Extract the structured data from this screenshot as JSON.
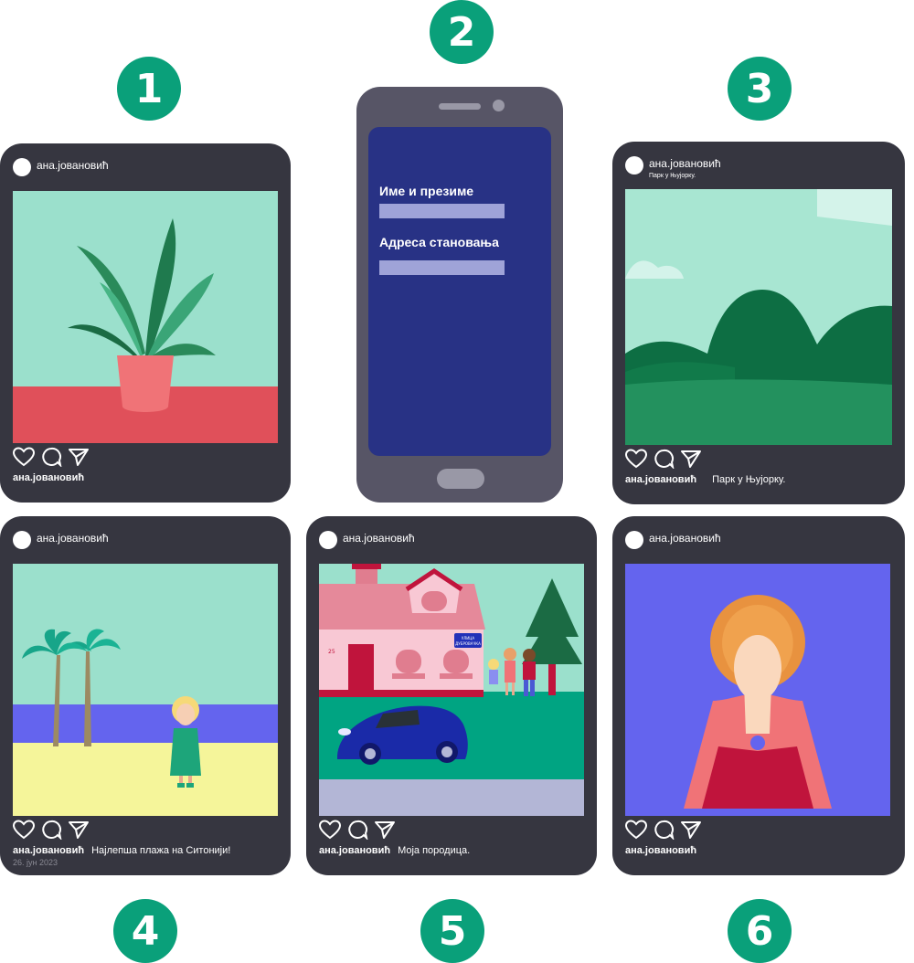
{
  "badges": [
    "1",
    "2",
    "3",
    "4",
    "5",
    "6"
  ],
  "username": "ана.јовановић",
  "phone": {
    "field1_label": "Име и презиме",
    "field2_label": "Адреса становања"
  },
  "posts": [
    {
      "id": 1,
      "caption": ""
    },
    {
      "id": 3,
      "location": "Парк у Њујорку.",
      "caption": "Парк у Њујорку."
    },
    {
      "id": 4,
      "caption": "Најлепша плажа на Ситонији!",
      "date": "26. јун 2023"
    },
    {
      "id": 5,
      "caption": "Моја породица.",
      "street_sign": "УЛИЦА ДУБРОВАЧКА",
      "house_number": "25"
    },
    {
      "id": 6,
      "caption": ""
    }
  ],
  "colors": {
    "badge": "#0aa07a",
    "card": "#363640",
    "phone_body": "#575566",
    "phone_screen": "#283285"
  },
  "icons": [
    "heart-icon",
    "comment-icon",
    "share-icon"
  ]
}
